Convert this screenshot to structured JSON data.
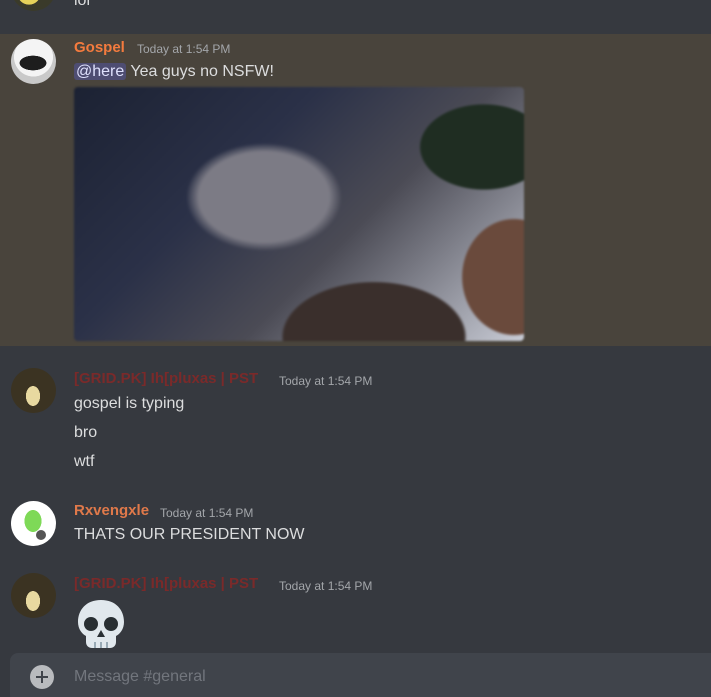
{
  "channel": "general",
  "colors": {
    "background": "#36393f",
    "mention_highlight": "#49443c",
    "gospel_name": "#f47b3e",
    "pluxas_name": "#7a2a2a",
    "rxvengxle_name": "#e0794a"
  },
  "top_message": {
    "text": "lol"
  },
  "messages": [
    {
      "username": "Gospel",
      "timestamp": "Today at 1:54 PM",
      "mention": "@here",
      "text": " Yea guys no NSFW!",
      "has_image": true
    },
    {
      "username": "[GRID.PK] Ih[pluxas | PST",
      "timestamp": "Today at 1:54 PM",
      "lines": [
        "gospel is typing",
        "bro",
        "wtf"
      ]
    },
    {
      "username": "Rxvengxle",
      "timestamp": "Today at 1:54 PM",
      "lines": [
        "THATS OUR PRESIDENT NOW"
      ]
    },
    {
      "username": "[GRID.PK] Ih[pluxas | PST",
      "timestamp": "Today at 1:54 PM",
      "emoji": "skull-emoji"
    }
  ],
  "composer": {
    "placeholder": "Message #general",
    "add_icon": "plus-circle-icon"
  }
}
